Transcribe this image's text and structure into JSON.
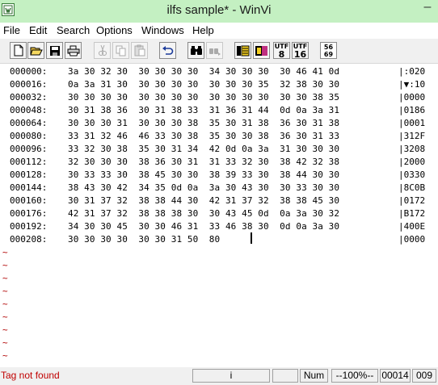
{
  "window": {
    "title": "ilfs sample* - WinVi",
    "minimize_glyph": "–"
  },
  "menu": {
    "items": [
      "File",
      "Edit",
      "Search",
      "Options",
      "Windows",
      "Help"
    ]
  },
  "toolbar": {
    "buttons": [
      {
        "name": "new-file",
        "icon": "new-file-icon",
        "enabled": true
      },
      {
        "name": "open-file",
        "icon": "open-folder-icon",
        "enabled": true
      },
      {
        "name": "save-file",
        "icon": "save-icon",
        "enabled": true
      },
      {
        "name": "print",
        "icon": "printer-icon",
        "enabled": true
      },
      {
        "name": "cut",
        "icon": "scissors-icon",
        "enabled": false
      },
      {
        "name": "copy",
        "icon": "copy-icon",
        "enabled": false
      },
      {
        "name": "paste",
        "icon": "paste-icon",
        "enabled": false
      },
      {
        "name": "undo",
        "icon": "undo-icon",
        "enabled": true
      },
      {
        "name": "find",
        "icon": "binoculars-icon",
        "enabled": true
      },
      {
        "name": "find-next",
        "icon": "binoculars-next-icon",
        "enabled": false
      },
      {
        "name": "hex-mode",
        "icon": "hex-mode-icon",
        "enabled": true
      },
      {
        "name": "dos-mode",
        "icon": "dos-mode-icon",
        "enabled": true
      },
      {
        "name": "utf8",
        "icon": "utf8-icon",
        "enabled": true
      },
      {
        "name": "utf16",
        "icon": "utf16-icon",
        "enabled": true
      },
      {
        "name": "charset",
        "icon": "charset-icon",
        "enabled": true
      }
    ],
    "utf8_top": "UTF",
    "utf8_bottom": "8",
    "utf16_top": "UTF",
    "utf16_bottom": "16",
    "charset_top": "56",
    "charset_bottom": "69"
  },
  "hex_rows": [
    {
      "offset": "000000:",
      "bytes": "3a 30 32 30  30 30 30 30  34 30 30 30  30 46 41 0d",
      "ascii": "|:020"
    },
    {
      "offset": "000016:",
      "bytes": "0a 3a 31 30  30 30 30 30  30 30 30 35  32 38 30 30",
      "ascii": "|▼:10"
    },
    {
      "offset": "000032:",
      "bytes": "30 30 30 30  30 30 30 30  30 30 30 30  30 30 38 35",
      "ascii": "|0000"
    },
    {
      "offset": "000048:",
      "bytes": "30 31 38 36  30 31 38 33  31 36 31 44  0d 0a 3a 31",
      "ascii": "|0186"
    },
    {
      "offset": "000064:",
      "bytes": "30 30 30 31  30 30 30 38  35 30 31 38  36 30 31 38",
      "ascii": "|0001"
    },
    {
      "offset": "000080:",
      "bytes": "33 31 32 46  46 33 30 38  35 30 30 38  36 30 31 33",
      "ascii": "|312F"
    },
    {
      "offset": "000096:",
      "bytes": "33 32 30 38  35 30 31 34  42 0d 0a 3a  31 30 30 30",
      "ascii": "|3208"
    },
    {
      "offset": "000112:",
      "bytes": "32 30 30 30  38 36 30 31  31 33 32 30  38 42 32 38",
      "ascii": "|2000"
    },
    {
      "offset": "000128:",
      "bytes": "30 33 33 30  38 45 30 30  38 39 33 30  38 44 30 30",
      "ascii": "|0330"
    },
    {
      "offset": "000144:",
      "bytes": "38 43 30 42  34 35 0d 0a  3a 30 43 30  30 33 30 30",
      "ascii": "|8C0B"
    },
    {
      "offset": "000160:",
      "bytes": "30 31 37 32  38 38 44 30  42 31 37 32  38 38 45 30",
      "ascii": "|0172"
    },
    {
      "offset": "000176:",
      "bytes": "42 31 37 32  38 38 38 30  30 43 45 0d  0a 3a 30 32",
      "ascii": "|B172"
    },
    {
      "offset": "000192:",
      "bytes": "34 30 30 45  30 30 46 31  33 46 38 30  0d 0a 3a 30",
      "ascii": "|400E"
    },
    {
      "offset": "000208:",
      "bytes": "30 30 30 30  30 30 31 50  80",
      "ascii": "|0000"
    }
  ],
  "tilde_char": "~",
  "status": {
    "message": "Tag not found",
    "mode": "i",
    "num_lock": "Num",
    "zoom": "--100%--",
    "line": "00014",
    "column": "009"
  }
}
